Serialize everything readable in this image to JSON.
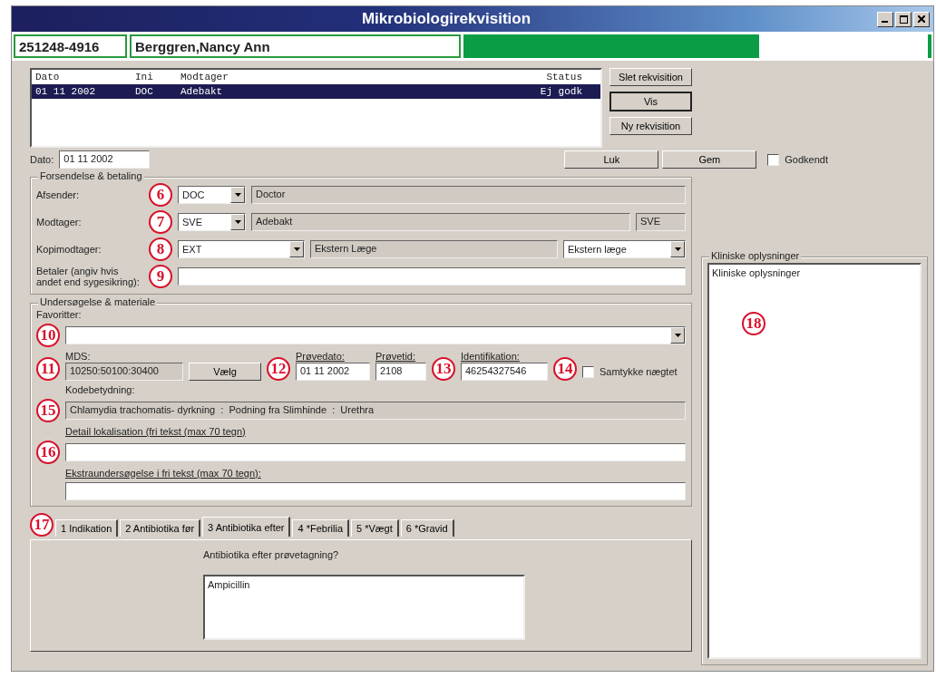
{
  "window": {
    "title": "Mikrobiologirekvisition"
  },
  "patient": {
    "cpr": "251248-4916",
    "name": "Berggren,Nancy Ann"
  },
  "requisitions": {
    "columns": [
      "Dato",
      "Ini",
      "Modtager",
      "Status"
    ],
    "rows": [
      {
        "cells": [
          "01 11 2002",
          "DOC",
          "Adebakt",
          "Ej godk"
        ],
        "selected": true
      }
    ]
  },
  "side_buttons": [
    {
      "label": "Slet rekvisition",
      "default": false
    },
    {
      "label": "Vis",
      "default": true
    },
    {
      "label": "Ny rekvisition",
      "default": false
    }
  ],
  "approved": {
    "label": "Godkendt",
    "checked": false
  },
  "date": {
    "label": "Dato:",
    "value": "01 11 2002"
  },
  "actions": [
    "Luk",
    "Gem"
  ],
  "shipping": {
    "title": "Forsendelse & betaling",
    "rows": [
      {
        "kind": "combo",
        "label": "Afsender:",
        "callout": "6",
        "code": "DOC",
        "description": "Doctor"
      },
      {
        "kind": "combo",
        "label": "Modtager:",
        "callout": "7",
        "code": "SVE",
        "description": "Adebakt",
        "extra": "SVE"
      },
      {
        "kind": "wide",
        "label": "Kopimodtager:",
        "callout": "8",
        "code": "EXT",
        "description": "Ekstern Læge",
        "select": "Ekstern læge"
      },
      {
        "kind": "text",
        "label": "Betaler (angiv hvis andet end sygesikring):",
        "callout": "9"
      }
    ]
  },
  "exam": {
    "title": "Undersøgelse & materiale",
    "favorites": {
      "label": "Favoritter:",
      "callout": "10"
    },
    "mds": {
      "label": "MDS:",
      "value": "10250:50100:30400",
      "callout": "11"
    },
    "choose_button": "Vælg",
    "sample_date": {
      "label": "Prøvedato:",
      "value": "01 11 2002",
      "callout": "12"
    },
    "sample_time": {
      "label": "Prøvetid:",
      "value": "2108"
    },
    "identification": {
      "label": "Identifikation:",
      "value": "46254327546",
      "callout": "13"
    },
    "consent": {
      "label": "Samtykke nægtet",
      "checked": false,
      "callout": "14"
    },
    "code_meaning": {
      "label": "Kodebetydning:",
      "value": "Chlamydia trachomatis- dyrkning  :  Podning fra Slimhinde  :  Urethra",
      "callout": "15"
    },
    "detail": {
      "label": "Detail lokalisation (fri tekst (max 70 tegn)",
      "callout": "16"
    },
    "extra": {
      "label": "Ekstraundersøgelse i fri tekst (max 70 tegn):"
    }
  },
  "tabs": {
    "callout": "17",
    "items": [
      {
        "label": "1 Indikation",
        "selected": false
      },
      {
        "label": "2 Antibiotika før",
        "selected": false
      },
      {
        "label": "3 Antibiotika efter",
        "selected": true
      },
      {
        "label": "4 *Febrilia",
        "selected": false
      },
      {
        "label": "5 *Vægt",
        "selected": false
      },
      {
        "label": "6 *Gravid",
        "selected": false
      }
    ],
    "question": "Antibiotika efter prøvetagning?",
    "answer": "Ampicillin"
  },
  "clinical": {
    "title": "Kliniske oplysninger",
    "value": "Kliniske oplysninger",
    "callout": "18"
  }
}
